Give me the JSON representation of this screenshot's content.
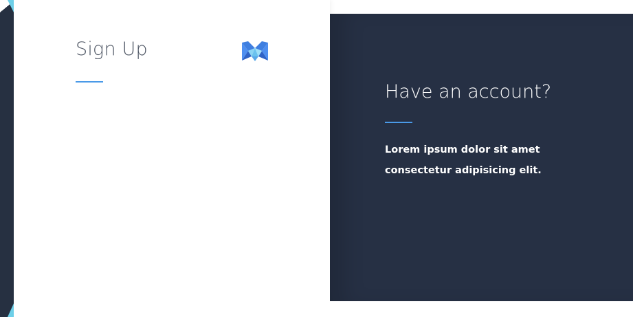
{
  "signup": {
    "title": "Sign Up"
  },
  "account_panel": {
    "title": "Have an account?",
    "description": "Lorem ipsum dolor sit amet consectetur adipisicing elit."
  },
  "colors": {
    "panel_background": "#263044",
    "accent_underline": "#4a9ae8",
    "left_accent": "#6ed0e9"
  },
  "icons": {
    "logo": "m-logo-icon"
  }
}
